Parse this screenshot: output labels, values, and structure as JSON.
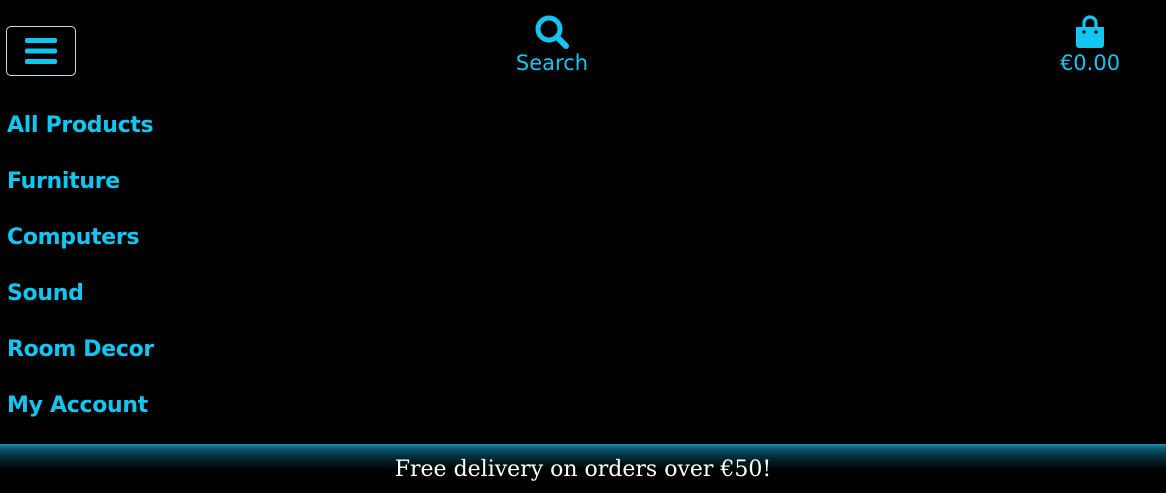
{
  "header": {
    "menu_icon": "hamburger-icon",
    "search": {
      "icon": "search-icon",
      "label": "Search"
    },
    "bag": {
      "icon": "shopping-bag-icon",
      "label": "€0.00"
    }
  },
  "nav": {
    "items": [
      {
        "label": "All Products"
      },
      {
        "label": "Furniture"
      },
      {
        "label": "Computers"
      },
      {
        "label": "Sound"
      },
      {
        "label": "Room Decor"
      },
      {
        "label": "My Account"
      }
    ]
  },
  "banner": {
    "text": "Free delivery on orders over €50!"
  },
  "colors": {
    "accent": "#13c6f1",
    "background": "#000000",
    "banner_text": "#ffffff"
  }
}
